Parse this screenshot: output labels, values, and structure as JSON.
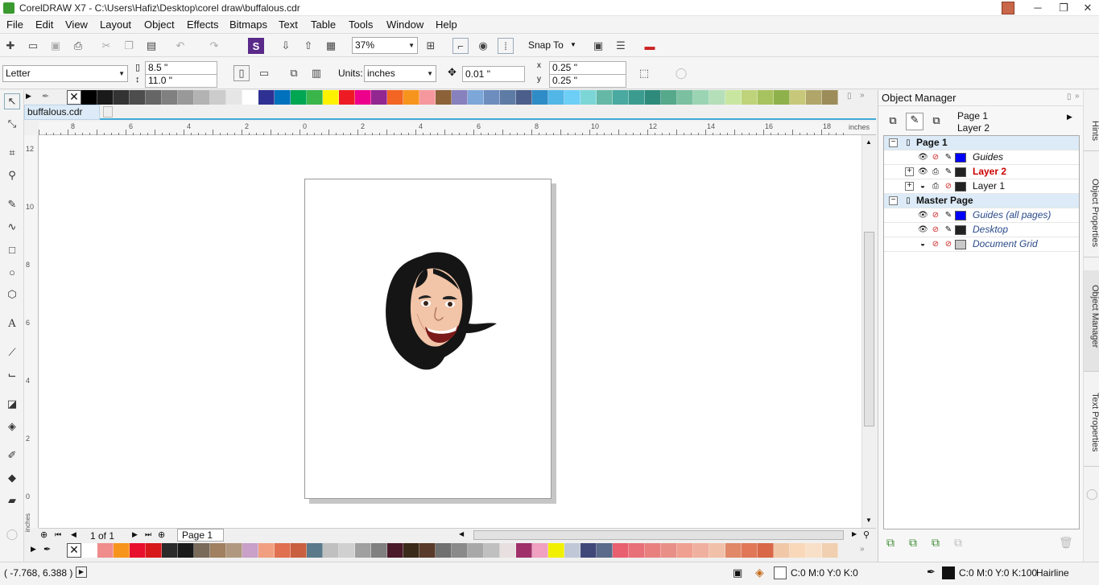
{
  "window": {
    "title": "CorelDRAW X7 - C:\\Users\\Hafiz\\Desktop\\corel draw\\buffalous.cdr",
    "controls": {
      "minimize": "─",
      "maximize": "❐",
      "close": "✕"
    }
  },
  "menubar": {
    "items": [
      "File",
      "Edit",
      "View",
      "Layout",
      "Object",
      "Effects",
      "Bitmaps",
      "Text",
      "Table",
      "Tools",
      "Window",
      "Help"
    ]
  },
  "standard_toolbar": {
    "zoom_level": "37%",
    "snap_to_label": "Snap To"
  },
  "property_bar": {
    "paper_size": "Letter",
    "page_width": "8.5 \"",
    "page_height": "11.0 \"",
    "units_label": "Units:",
    "units_value": "inches",
    "nudge": "0.01 \"",
    "dup_x": "0.25 \"",
    "dup_y": "0.25 \""
  },
  "document": {
    "tab_name": "buffalous.cdr",
    "ruler_unit": "inches",
    "vruler_unit": "inches",
    "h_ruler_ticks": [
      "8",
      "6",
      "4",
      "2",
      "0",
      "2",
      "4",
      "6",
      "8",
      "10",
      "12",
      "14",
      "16",
      "18"
    ],
    "v_ruler_ticks": [
      "12",
      "10",
      "8",
      "6",
      "4",
      "2",
      "0"
    ],
    "page_counter": "1 of 1",
    "page_tab": "Page 1"
  },
  "status_bar": {
    "coordinates": "( -7.768, 6.388 )",
    "fill_color": "C:0 M:0 Y:0 K:0",
    "outline_color": "C:0 M:0 Y:0 K:100",
    "outline_width": "Hairline"
  },
  "object_manager": {
    "title": "Object Manager",
    "current_page": "Page 1",
    "current_layer": "Layer 2",
    "tree": [
      {
        "label": "Page 1",
        "type": "group",
        "color": "#cfe3f5"
      },
      {
        "label": "Guides",
        "type": "layer",
        "color": "#0000ff",
        "style": "italic",
        "text_color": "#111111"
      },
      {
        "label": "Layer 2",
        "type": "layer",
        "color": "#222222",
        "style": "bold",
        "text_color": "#cc0000",
        "expandable": true
      },
      {
        "label": "Layer 1",
        "type": "layer",
        "color": "#222222",
        "style": "normal",
        "text_color": "#111111",
        "expandable": true
      },
      {
        "label": "Master Page",
        "type": "group",
        "color": "#cfe3f5"
      },
      {
        "label": "Guides (all pages)",
        "type": "layer",
        "color": "#0000ff",
        "style": "italic",
        "text_color": "#2a4a8a"
      },
      {
        "label": "Desktop",
        "type": "layer",
        "color": "#222222",
        "style": "italic",
        "text_color": "#2a4a8a"
      },
      {
        "label": "Document Grid",
        "type": "layer",
        "color": "#c8c8c8",
        "style": "italic",
        "text_color": "#2a4a8a"
      }
    ]
  },
  "dock_tabs": [
    "Hints",
    "Object Properties",
    "Object Manager",
    "Text Properties"
  ],
  "palette_top": [
    "#000000",
    "#1a1a1a",
    "#333333",
    "#4d4d4d",
    "#666666",
    "#808080",
    "#999999",
    "#b3b3b3",
    "#cccccc",
    "#e6e6e6",
    "#ffffff",
    "#2e3192",
    "#0071bc",
    "#00a651",
    "#39b54a",
    "#fff200",
    "#ed1c24",
    "#ec008c",
    "#92278f",
    "#f26522",
    "#f7941d",
    "#f5989d",
    "#8c6239",
    "#8781bd",
    "#7da7d9",
    "#6d8dbf",
    "#5e7ba5",
    "#4b5f8a",
    "#2f8cc6",
    "#52b6e6",
    "#6dcff6",
    "#7dd6d6",
    "#66b8a6",
    "#4aa9a0",
    "#3c9b8f",
    "#2e8b7b",
    "#56a98b",
    "#7bc0a0",
    "#9ad4b3",
    "#b5dfb8",
    "#c8e6a0",
    "#bfd37a",
    "#a7c35f",
    "#8fb14b",
    "#c8c87a",
    "#b0a66a",
    "#9c8c5a"
  ],
  "palette_bottom": [
    "#ffffff",
    "#f08c8c",
    "#f7941d",
    "#e8112d",
    "#d7191c",
    "#2b2b2b",
    "#1a1a1a",
    "#7a6a5a",
    "#a08060",
    "#b09880",
    "#c8a0c8",
    "#f0a080",
    "#e07050",
    "#c86040",
    "#5a7a8a",
    "#c0c0c0",
    "#d0d0d0",
    "#a0a0a0",
    "#808080",
    "#4a1a2a",
    "#3a2a1a",
    "#5a3a2a",
    "#707070",
    "#8a8a8a",
    "#a8a8a8",
    "#c0c0c0",
    "#e8e0e0",
    "#a0306a",
    "#f0a0c0",
    "#f0f000",
    "#c0c8d8",
    "#404878",
    "#5a6a8a",
    "#e86070",
    "#e87078",
    "#e88080",
    "#e89088",
    "#f0a090",
    "#f0b0a0",
    "#f0c0a8",
    "#e08868",
    "#e07858",
    "#d86848",
    "#f0c8a8",
    "#f8d8b8",
    "#f8e0c8",
    "#f0d0b0"
  ]
}
